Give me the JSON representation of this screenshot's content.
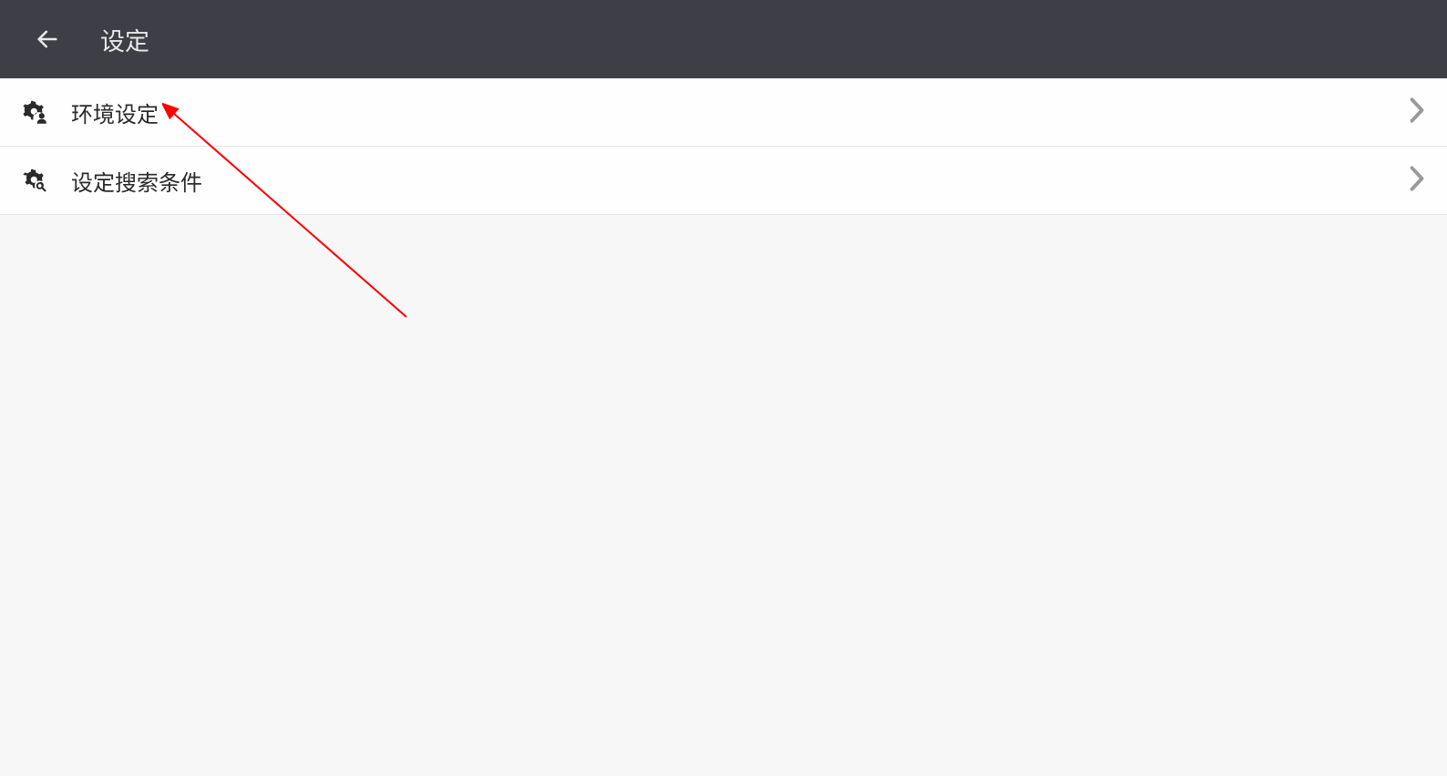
{
  "header": {
    "title": "设定"
  },
  "items": [
    {
      "label": "环境设定",
      "icon": "gear-user"
    },
    {
      "label": "设定搜索条件",
      "icon": "gear-search"
    }
  ]
}
